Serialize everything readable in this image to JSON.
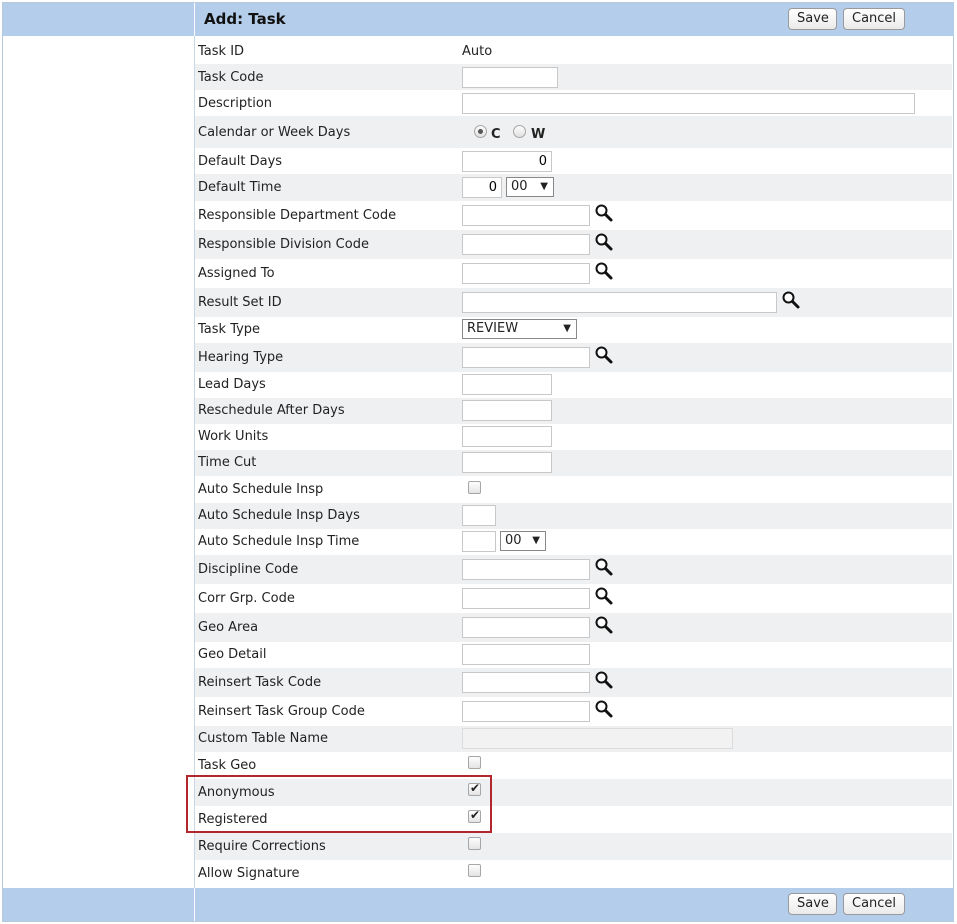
{
  "header": {
    "title": "Add: Task",
    "save_label": "Save",
    "cancel_label": "Cancel"
  },
  "footer": {
    "save_label": "Save",
    "cancel_label": "Cancel"
  },
  "fields": {
    "task_id": {
      "label": "Task ID",
      "value": "Auto"
    },
    "task_code": {
      "label": "Task Code",
      "value": ""
    },
    "description": {
      "label": "Description",
      "value": ""
    },
    "calendar_or_week_days": {
      "label": "Calendar or Week Days",
      "option_c": "C",
      "option_w": "W",
      "selected": "C"
    },
    "default_days": {
      "label": "Default Days",
      "value": "0"
    },
    "default_time": {
      "label": "Default Time",
      "hours": "0",
      "minutes": "00"
    },
    "responsible_department_code": {
      "label": "Responsible Department Code",
      "value": ""
    },
    "responsible_division_code": {
      "label": "Responsible Division Code",
      "value": ""
    },
    "assigned_to": {
      "label": "Assigned To",
      "value": ""
    },
    "result_set_id": {
      "label": "Result Set ID",
      "value": ""
    },
    "task_type": {
      "label": "Task Type",
      "value": "REVIEW"
    },
    "hearing_type": {
      "label": "Hearing Type",
      "value": ""
    },
    "lead_days": {
      "label": "Lead Days",
      "value": ""
    },
    "reschedule_after_days": {
      "label": "Reschedule After Days",
      "value": ""
    },
    "work_units": {
      "label": "Work Units",
      "value": ""
    },
    "time_cut": {
      "label": "Time Cut",
      "value": ""
    },
    "auto_schedule_insp": {
      "label": "Auto Schedule Insp",
      "checked": false
    },
    "auto_schedule_insp_days": {
      "label": "Auto Schedule Insp Days",
      "value": ""
    },
    "auto_schedule_insp_time": {
      "label": "Auto Schedule Insp Time",
      "hours": "",
      "minutes": "00"
    },
    "discipline_code": {
      "label": "Discipline Code",
      "value": ""
    },
    "corr_grp_code": {
      "label": "Corr Grp. Code",
      "value": ""
    },
    "geo_area": {
      "label": "Geo Area",
      "value": ""
    },
    "geo_detail": {
      "label": "Geo Detail",
      "value": ""
    },
    "reinsert_task_code": {
      "label": "Reinsert Task Code",
      "value": ""
    },
    "reinsert_task_group_code": {
      "label": "Reinsert Task Group Code",
      "value": ""
    },
    "custom_table_name": {
      "label": "Custom Table Name",
      "value": ""
    },
    "task_geo": {
      "label": "Task Geo",
      "checked": false
    },
    "anonymous": {
      "label": "Anonymous",
      "checked": true
    },
    "registered": {
      "label": "Registered",
      "checked": true
    },
    "require_corrections": {
      "label": "Require Corrections",
      "checked": false
    },
    "allow_signature": {
      "label": "Allow Signature",
      "checked": false
    }
  },
  "icons": {
    "lookup": "magnifier-icon",
    "dropdown": "triangle-down-icon",
    "checkmark": "check-icon"
  },
  "colors": {
    "header_bg": "#b4cdea",
    "row_shade": "#eef0f1",
    "highlight_border": "#b3262b"
  }
}
